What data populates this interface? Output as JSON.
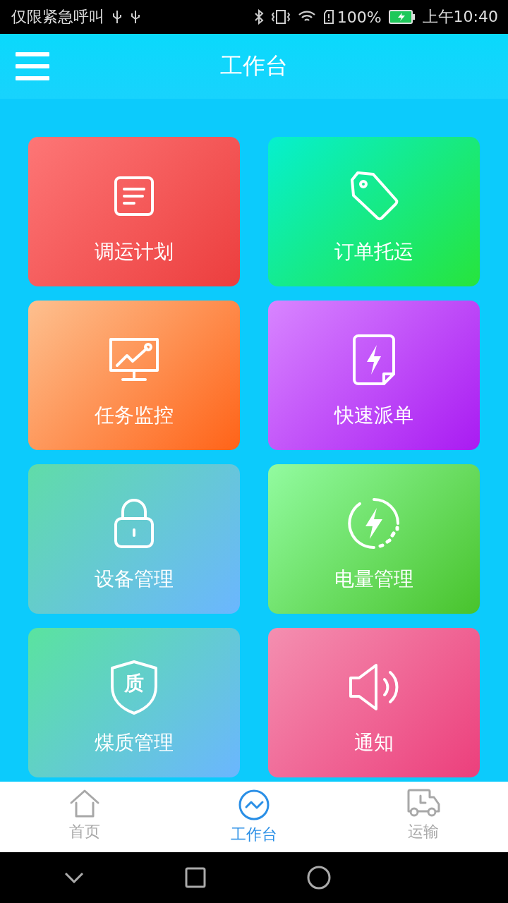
{
  "status_bar": {
    "carrier": "仅限紧急呼叫",
    "battery": "100%",
    "time": "上午10:40"
  },
  "header": {
    "title": "工作台"
  },
  "tiles": [
    {
      "kind": "document",
      "label": "调运计划"
    },
    {
      "kind": "tag",
      "label": "订单托运"
    },
    {
      "kind": "chart",
      "label": "任务监控"
    },
    {
      "kind": "flash-doc",
      "label": "快速派单"
    },
    {
      "kind": "lock",
      "label": "设备管理"
    },
    {
      "kind": "power",
      "label": "电量管理"
    },
    {
      "kind": "shield",
      "label": "煤质管理",
      "glyph": "质"
    },
    {
      "kind": "speaker",
      "label": "通知"
    }
  ],
  "bottom_nav": [
    {
      "kind": "home",
      "label": "首页",
      "selected": false
    },
    {
      "kind": "chart",
      "label": "工作台",
      "selected": true
    },
    {
      "kind": "truck",
      "label": "运输",
      "selected": false
    }
  ]
}
